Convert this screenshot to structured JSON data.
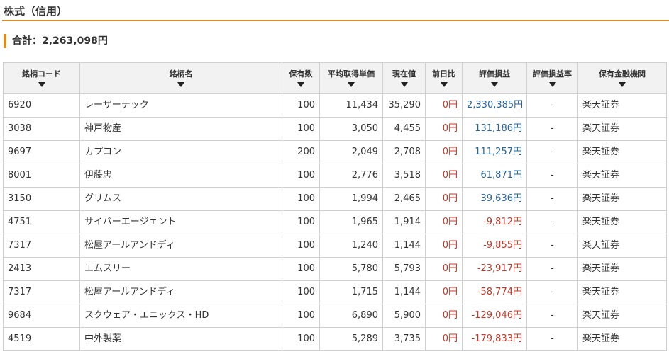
{
  "section": {
    "title": "株式（信用）"
  },
  "summary": {
    "total_label": "合計：",
    "total_value": "2,263,098円"
  },
  "columns": [
    "銘柄コード",
    "銘柄名",
    "保有数",
    "平均取得単価",
    "現在値",
    "前日比",
    "評価損益",
    "評価損益率",
    "保有金融機関"
  ],
  "rows": [
    {
      "code": "6920",
      "name": "レーザーテック",
      "qty": "100",
      "avg": "11,434",
      "price": "35,290",
      "change": "0円",
      "pl": "2,330,385円",
      "pl_sign": "pos",
      "rate": "-",
      "inst": "楽天証券"
    },
    {
      "code": "3038",
      "name": "神戸物産",
      "qty": "100",
      "avg": "3,050",
      "price": "4,455",
      "change": "0円",
      "pl": "131,186円",
      "pl_sign": "pos",
      "rate": "-",
      "inst": "楽天証券"
    },
    {
      "code": "9697",
      "name": "カプコン",
      "qty": "200",
      "avg": "2,049",
      "price": "2,708",
      "change": "0円",
      "pl": "111,257円",
      "pl_sign": "pos",
      "rate": "-",
      "inst": "楽天証券"
    },
    {
      "code": "8001",
      "name": "伊藤忠",
      "qty": "100",
      "avg": "2,776",
      "price": "3,518",
      "change": "0円",
      "pl": "61,871円",
      "pl_sign": "pos",
      "rate": "-",
      "inst": "楽天証券"
    },
    {
      "code": "3150",
      "name": "グリムス",
      "qty": "100",
      "avg": "1,994",
      "price": "2,465",
      "change": "0円",
      "pl": "39,636円",
      "pl_sign": "pos",
      "rate": "-",
      "inst": "楽天証券"
    },
    {
      "code": "4751",
      "name": "サイバーエージェント",
      "qty": "100",
      "avg": "1,965",
      "price": "1,914",
      "change": "0円",
      "pl": "-9,812円",
      "pl_sign": "neg",
      "rate": "-",
      "inst": "楽天証券"
    },
    {
      "code": "7317",
      "name": "松屋アールアンドディ",
      "qty": "100",
      "avg": "1,240",
      "price": "1,144",
      "change": "0円",
      "pl": "-9,855円",
      "pl_sign": "neg",
      "rate": "-",
      "inst": "楽天証券"
    },
    {
      "code": "2413",
      "name": "エムスリー",
      "qty": "100",
      "avg": "5,780",
      "price": "5,793",
      "change": "0円",
      "pl": "-23,917円",
      "pl_sign": "neg",
      "rate": "-",
      "inst": "楽天証券"
    },
    {
      "code": "7317",
      "name": "松屋アールアンドディ",
      "qty": "100",
      "avg": "1,715",
      "price": "1,144",
      "change": "0円",
      "pl": "-58,774円",
      "pl_sign": "neg",
      "rate": "-",
      "inst": "楽天証券"
    },
    {
      "code": "9684",
      "name": "スクウェア・エニックス・HD",
      "qty": "100",
      "avg": "6,890",
      "price": "5,900",
      "change": "0円",
      "pl": "-129,046円",
      "pl_sign": "neg",
      "rate": "-",
      "inst": "楽天証券"
    },
    {
      "code": "4519",
      "name": "中外製薬",
      "qty": "100",
      "avg": "5,289",
      "price": "3,735",
      "change": "0円",
      "pl": "-179,833円",
      "pl_sign": "neg",
      "rate": "-",
      "inst": "楽天証券"
    }
  ],
  "colors": {
    "accent": "#d88a2c",
    "positive": "#2a6496",
    "negative": "#c0392b",
    "header_bg": "#f2f2f2"
  },
  "icons": {
    "sort": "sort-down-arrow-icon"
  }
}
